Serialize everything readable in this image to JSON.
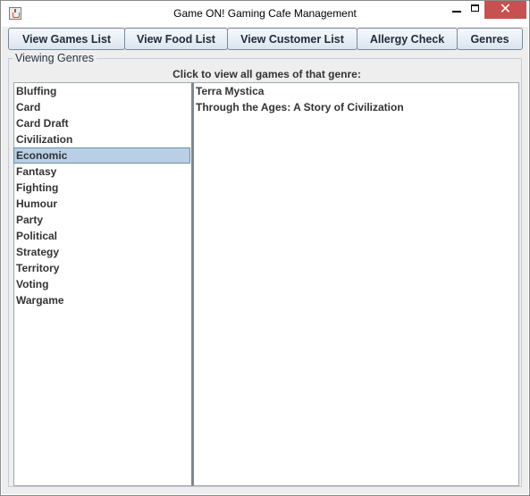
{
  "window": {
    "title": "Game ON! Gaming Cafe Management",
    "icon": "java-cup-icon",
    "controls": {
      "minimize": "minimize-icon",
      "maximize": "maximize-icon",
      "close": "✕"
    }
  },
  "nav": {
    "buttons": [
      {
        "label": "View Games List"
      },
      {
        "label": "View Food List"
      },
      {
        "label": "View Customer List"
      },
      {
        "label": "Allergy Check"
      },
      {
        "label": "Genres"
      }
    ]
  },
  "panel": {
    "title": "Viewing Genres",
    "instruction": "Click to view all games of that genre:"
  },
  "genres": {
    "items": [
      "Bluffing",
      "Card",
      "Card Draft",
      "Civilization",
      "Economic",
      "Fantasy",
      "Fighting",
      "Humour",
      "Party",
      "Political",
      "Strategy",
      "Territory",
      "Voting",
      "Wargame"
    ],
    "selected": "Economic"
  },
  "games": {
    "items": [
      "Terra Mystica",
      "Through the Ages: A Story of Civilization"
    ]
  },
  "colors": {
    "selection": "#b8cfe5",
    "close_button": "#c75050",
    "content_bg": "#eeeeee"
  }
}
